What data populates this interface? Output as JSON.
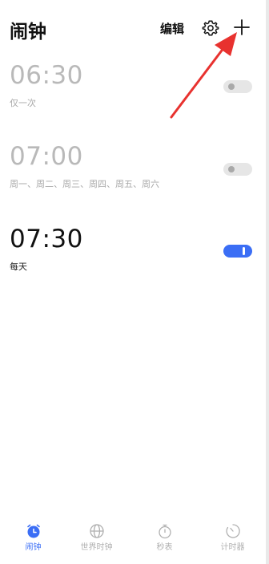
{
  "header": {
    "title": "闹钟",
    "edit_label": "编辑",
    "settings_icon": "gear-icon",
    "add_icon": "plus-icon"
  },
  "alarms": [
    {
      "time": "06:30",
      "repeat": "仅一次",
      "enabled": false
    },
    {
      "time": "07:00",
      "repeat": "周一、周二、周三、周四、周五、周六",
      "enabled": false
    },
    {
      "time": "07:30",
      "repeat": "每天",
      "enabled": true
    }
  ],
  "tabs": [
    {
      "label": "闹钟",
      "icon": "alarm-clock-icon",
      "active": true
    },
    {
      "label": "世界时钟",
      "icon": "globe-icon",
      "active": false
    },
    {
      "label": "秒表",
      "icon": "stopwatch-icon",
      "active": false
    },
    {
      "label": "计时器",
      "icon": "timer-icon",
      "active": false
    }
  ],
  "colors": {
    "accent": "#3b6ef5",
    "annotation": "#e8322f",
    "disabled_text": "#b9b9b9"
  }
}
